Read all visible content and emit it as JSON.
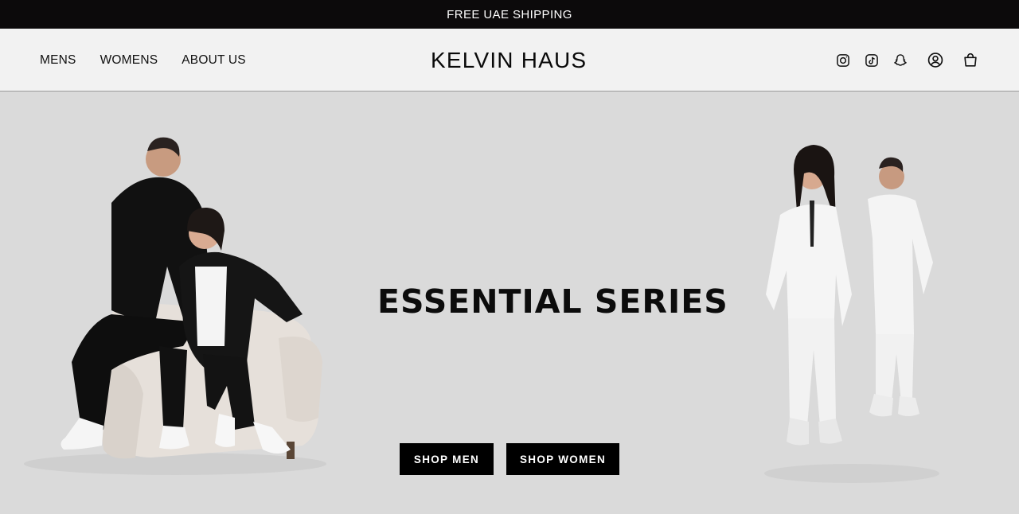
{
  "announcement": {
    "text": "FREE UAE SHIPPING"
  },
  "header": {
    "nav": [
      {
        "label": "MENS"
      },
      {
        "label": "WOMENS"
      },
      {
        "label": "ABOUT US"
      }
    ],
    "logo": "KELVIN HAUS",
    "icons": [
      "instagram-icon",
      "tiktok-icon",
      "snapchat-icon",
      "account-icon",
      "cart-icon"
    ]
  },
  "hero": {
    "title": "ESSENTIAL SERIES",
    "buttons": {
      "men": "SHOP MEN",
      "women": "SHOP WOMEN"
    },
    "images": [
      "black-tracksuit-couple-photo",
      "white-tracksuit-couple-photo"
    ]
  },
  "colors": {
    "announcement_bg": "#0c0a0b",
    "header_bg": "#f2f2f2",
    "hero_bg": "#dadada",
    "button_bg": "#000000"
  }
}
